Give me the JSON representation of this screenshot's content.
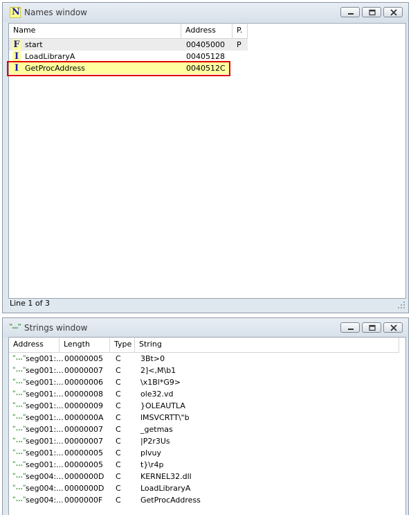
{
  "names_window": {
    "title": "Names window",
    "icon": "N",
    "columns": [
      "Name",
      "Address",
      "P."
    ],
    "rows": [
      {
        "type": "F",
        "name": "start",
        "address": "00405000",
        "p": "P"
      },
      {
        "type": "I",
        "name": "LoadLibraryA",
        "address": "00405128",
        "p": ""
      },
      {
        "type": "I",
        "name": "GetProcAddress",
        "address": "0040512C",
        "p": ""
      }
    ],
    "status": "Line 1 of 3"
  },
  "strings_window": {
    "title": "Strings window",
    "icon": "\"...\"",
    "columns": [
      "Address",
      "Length",
      "Type",
      "String"
    ],
    "rows": [
      {
        "address": "seg001:...",
        "length": "00000005",
        "type": "C",
        "string": "3Bt>0"
      },
      {
        "address": "seg001:...",
        "length": "00000007",
        "type": "C",
        "string": "2]<,M\\b1"
      },
      {
        "address": "seg001:...",
        "length": "00000006",
        "type": "C",
        "string": "\\x1Bl*G9>"
      },
      {
        "address": "seg001:...",
        "length": "00000008",
        "type": "C",
        "string": "ole32.vd"
      },
      {
        "address": "seg001:...",
        "length": "00000009",
        "type": "C",
        "string": "}OLEAUTLA"
      },
      {
        "address": "seg001:...",
        "length": "0000000A",
        "type": "C",
        "string": "lMSVCRTT\\\"b"
      },
      {
        "address": "seg001:...",
        "length": "00000007",
        "type": "C",
        "string": "_getmas"
      },
      {
        "address": "seg001:...",
        "length": "00000007",
        "type": "C",
        "string": "|P2r3Us"
      },
      {
        "address": "seg001:...",
        "length": "00000005",
        "type": "C",
        "string": "plvuy"
      },
      {
        "address": "seg001:...",
        "length": "00000005",
        "type": "C",
        "string": "t}\\r4p"
      },
      {
        "address": "seg004:...",
        "length": "0000000D",
        "type": "C",
        "string": "KERNEL32.dll"
      },
      {
        "address": "seg004:...",
        "length": "0000000D",
        "type": "C",
        "string": "LoadLibraryA"
      },
      {
        "address": "seg004:...",
        "length": "0000000F",
        "type": "C",
        "string": "GetProcAddress"
      }
    ]
  },
  "colors": {
    "selected_row_bg": "#ffff9f",
    "selection_border": "#e00000",
    "function_icon_color": "#1a1aa6",
    "import_icon_color": "#1a1aa6"
  },
  "icons": {
    "minimize": "minimize-icon",
    "restore": "restore-icon",
    "close": "close-icon",
    "function": "function-icon",
    "import": "import-icon",
    "string": "string-icon",
    "resize_grip": "resize-grip-icon"
  }
}
